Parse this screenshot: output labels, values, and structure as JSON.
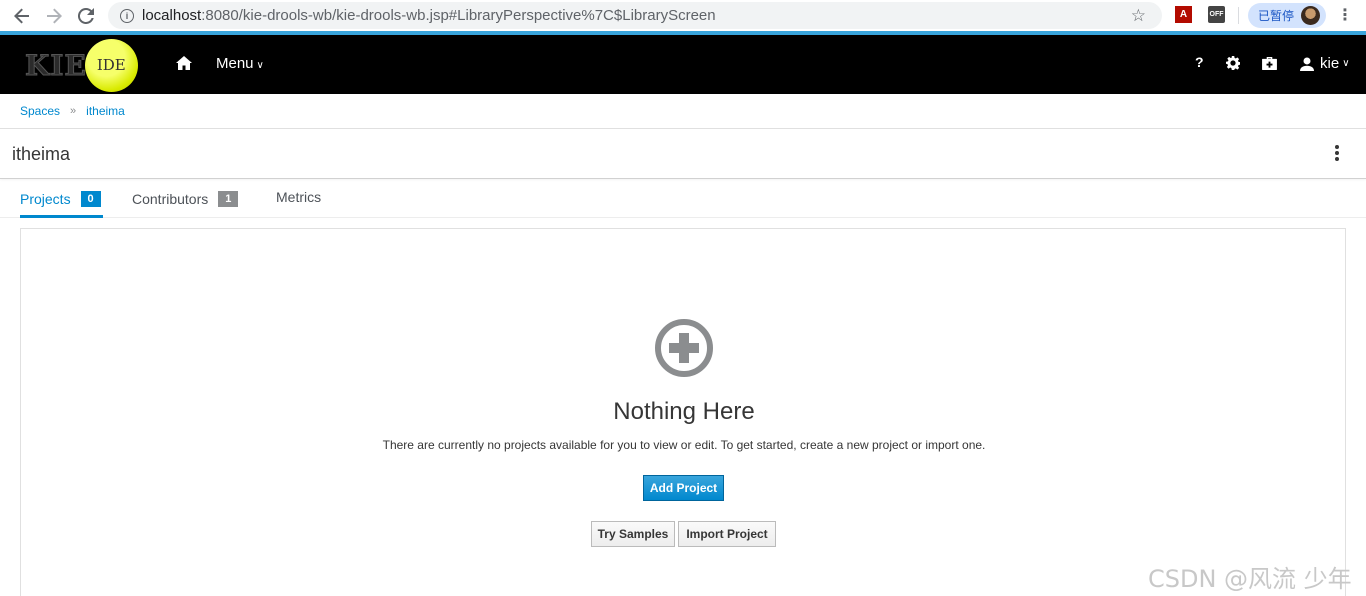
{
  "browser": {
    "url_host": "localhost",
    "url_rest": ":8080/kie-drools-wb/kie-drools-wb.jsp#LibraryPerspective%7C$LibraryScreen",
    "pdf_ext": "A",
    "off_ext": "OFF",
    "profile_status": "已暂停"
  },
  "header": {
    "logo_text": "KIE",
    "logo_badge": "IDE",
    "menu_label": "Menu",
    "user_label": "kie"
  },
  "breadcrumb": {
    "items": [
      "Spaces",
      "itheima"
    ],
    "separator": "»"
  },
  "page": {
    "title": "itheima"
  },
  "tabs": [
    {
      "label": "Projects",
      "badge": "0",
      "active": true
    },
    {
      "label": "Contributors",
      "badge": "1",
      "active": false
    },
    {
      "label": "Metrics",
      "badge": null,
      "active": false
    }
  ],
  "empty_state": {
    "title": "Nothing Here",
    "description": "There are currently no projects available for you to view or edit. To get started, create a new project or import one.",
    "primary_button": "Add Project",
    "secondary_buttons": [
      "Try Samples",
      "Import Project"
    ]
  },
  "watermark": "CSDN @风流 少年",
  "colors": {
    "accent": "#0088ce",
    "header_bg": "#000000",
    "badge_grey": "#8b8d8f",
    "browser_strip": "#39a5dc"
  }
}
